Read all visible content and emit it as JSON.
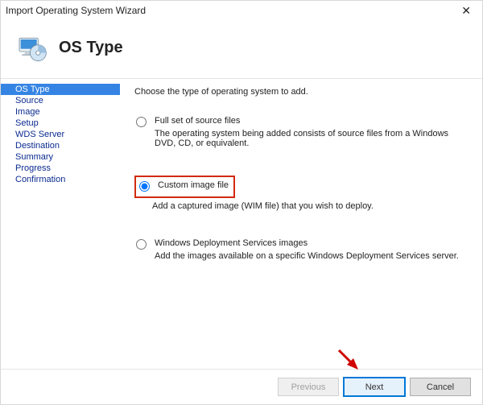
{
  "window": {
    "title": "Import Operating System Wizard",
    "close": "✕"
  },
  "page": {
    "title": "OS Type",
    "instructions": "Choose the type of operating system to add."
  },
  "sidebar": {
    "items": [
      {
        "label": "OS Type",
        "selected": true
      },
      {
        "label": "Source"
      },
      {
        "label": "Image"
      },
      {
        "label": "Setup"
      },
      {
        "label": "WDS Server"
      },
      {
        "label": "Destination"
      },
      {
        "label": "Summary"
      },
      {
        "label": "Progress"
      },
      {
        "label": "Confirmation"
      }
    ]
  },
  "options": {
    "full": {
      "title": "Full set of source files",
      "desc": "The operating system being added consists of source files from a Windows DVD, CD, or equivalent."
    },
    "custom": {
      "title": "Custom image file",
      "desc": "Add a captured image (WIM file) that you wish to deploy."
    },
    "wds": {
      "title": "Windows Deployment Services images",
      "desc": "Add the images available on a specific Windows Deployment Services server."
    }
  },
  "buttons": {
    "previous": "Previous",
    "next": "Next",
    "cancel": "Cancel"
  }
}
